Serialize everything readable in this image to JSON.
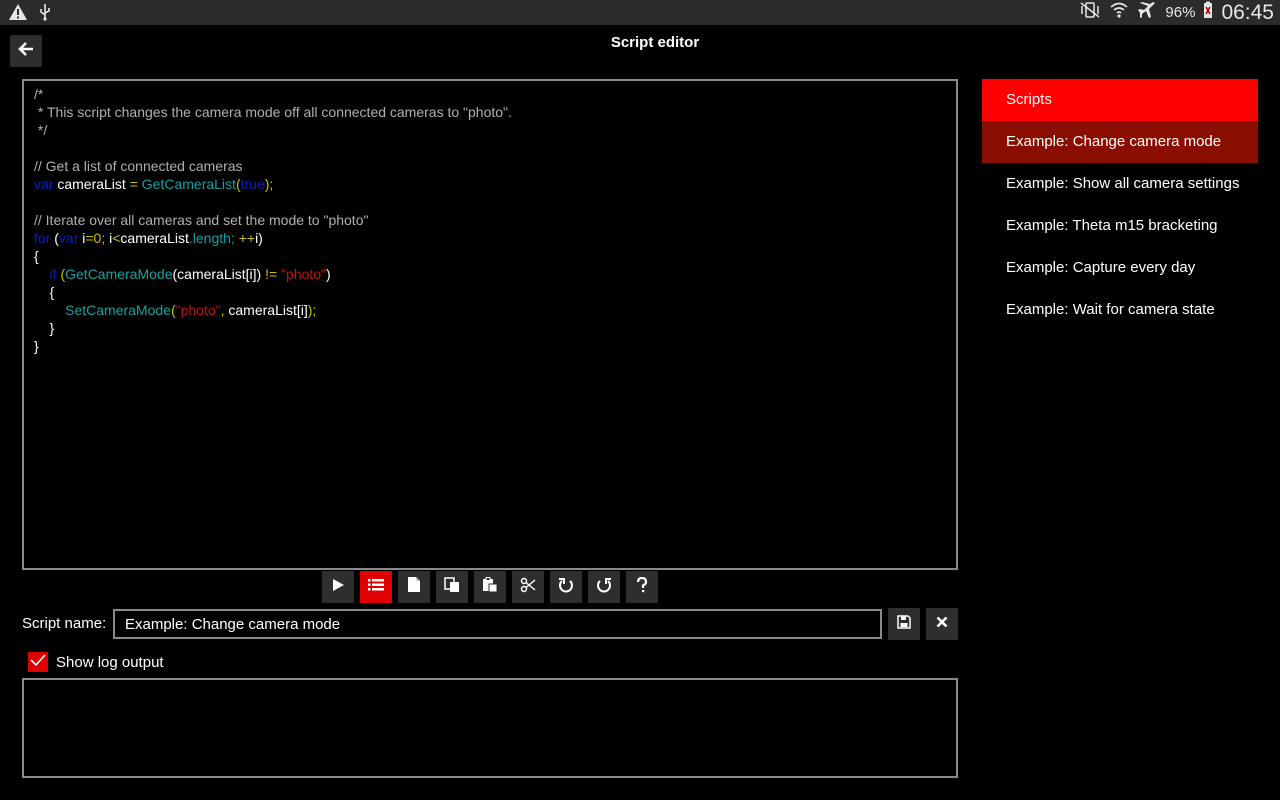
{
  "status_bar": {
    "battery_percent": "96%",
    "time": "06:45"
  },
  "header": {
    "title": "Script editor"
  },
  "editor": {
    "lines": [
      [
        {
          "t": "/*",
          "c": "com"
        }
      ],
      [
        {
          "t": " * This script changes the camera mode off all connected cameras to \"photo\".",
          "c": "com"
        }
      ],
      [
        {
          "t": " */",
          "c": "com"
        }
      ],
      [],
      [
        {
          "t": "// Get a list of connected cameras",
          "c": "com"
        }
      ],
      [
        {
          "t": "var",
          "c": "kw"
        },
        {
          "t": " cameraList ",
          "c": ""
        },
        {
          "t": "=",
          "c": "op"
        },
        {
          "t": " ",
          "c": ""
        },
        {
          "t": "GetCameraList",
          "c": "fn"
        },
        {
          "t": "(",
          "c": "op"
        },
        {
          "t": "true",
          "c": "kw"
        },
        {
          "t": ");",
          "c": "op"
        }
      ],
      [],
      [
        {
          "t": "// Iterate over all cameras and set the mode to \"photo\"",
          "c": "com"
        }
      ],
      [
        {
          "t": "for",
          "c": "kw"
        },
        {
          "t": " (",
          "c": ""
        },
        {
          "t": "var",
          "c": "kw"
        },
        {
          "t": " i",
          "c": ""
        },
        {
          "t": "=0;",
          "c": "num"
        },
        {
          "t": " i",
          "c": ""
        },
        {
          "t": "<",
          "c": "op"
        },
        {
          "t": "cameraList",
          "c": ""
        },
        {
          "t": ".length;",
          "c": "fn"
        },
        {
          "t": " ",
          "c": ""
        },
        {
          "t": "++",
          "c": "op"
        },
        {
          "t": "i)",
          "c": ""
        }
      ],
      [
        {
          "t": "{",
          "c": ""
        }
      ],
      [
        {
          "t": "    ",
          "c": ""
        },
        {
          "t": "if",
          "c": "kw"
        },
        {
          "t": " (",
          "c": "op"
        },
        {
          "t": "GetCameraMode",
          "c": "fn"
        },
        {
          "t": "(cameraList[i])",
          "c": ""
        },
        {
          "t": " != ",
          "c": "op"
        },
        {
          "t": "\"photo\"",
          "c": "str"
        },
        {
          "t": ")",
          "c": ""
        }
      ],
      [
        {
          "t": "    {",
          "c": ""
        }
      ],
      [
        {
          "t": "        ",
          "c": ""
        },
        {
          "t": "SetCameraMode",
          "c": "fn"
        },
        {
          "t": "(",
          "c": "op"
        },
        {
          "t": "\"photo\"",
          "c": "str"
        },
        {
          "t": ",",
          "c": "op"
        },
        {
          "t": " cameraList[i]",
          "c": ""
        },
        {
          "t": ");",
          "c": "op"
        }
      ],
      [
        {
          "t": "    }",
          "c": ""
        }
      ],
      [
        {
          "t": "}",
          "c": ""
        }
      ]
    ]
  },
  "toolbar": {
    "buttons": [
      {
        "name": "run-button",
        "icon": "play-icon"
      },
      {
        "name": "list-button",
        "icon": "list-icon",
        "active": true
      },
      {
        "name": "new-button",
        "icon": "new-file-icon"
      },
      {
        "name": "copy-button",
        "icon": "copy-icon"
      },
      {
        "name": "paste-button",
        "icon": "paste-icon"
      },
      {
        "name": "cut-button",
        "icon": "scissors-icon"
      },
      {
        "name": "undo-button",
        "icon": "undo-icon"
      },
      {
        "name": "redo-button",
        "icon": "redo-icon"
      },
      {
        "name": "help-button",
        "icon": "help-icon"
      }
    ]
  },
  "script_name": {
    "label": "Script name:",
    "value": "Example: Change camera mode"
  },
  "log": {
    "show_label": "Show log output",
    "checked": true
  },
  "scripts": {
    "header": "Scripts",
    "items": [
      {
        "label": "Example: Change camera mode",
        "selected": true
      },
      {
        "label": "Example: Show all camera settings"
      },
      {
        "label": "Example: Theta m15 bracketing"
      },
      {
        "label": "Example: Capture every day"
      },
      {
        "label": "Example: Wait for camera state"
      }
    ]
  },
  "colors": {
    "accent": "#ff0000",
    "selected": "#8a0e00"
  }
}
